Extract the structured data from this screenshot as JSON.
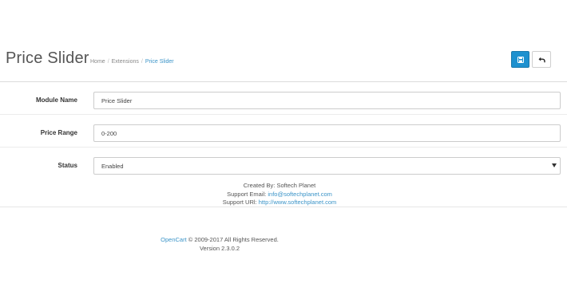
{
  "header": {
    "title": "Price Slider",
    "breadcrumb": [
      "Home",
      "Extensions",
      "Price Slider"
    ],
    "separator": "/"
  },
  "toolbar": {
    "save_icon": "save-icon",
    "back_icon": "back-arrow-icon",
    "save_color": "#1e91cf"
  },
  "form": {
    "module_name": {
      "label": "Module Name",
      "value": "Price Slider"
    },
    "price_range": {
      "label": "Price Range",
      "value": "0-200"
    },
    "status": {
      "label": "Status",
      "value": "Enabled"
    }
  },
  "credits": {
    "created_by": "Created By: Softech Planet",
    "email_label": "Support Email:",
    "email": "info@softechplanet.com",
    "url_label": "Support URl:",
    "url": "http://www.softechplanet.com"
  },
  "footer": {
    "brand": "OpenCart",
    "copyright": "© 2009-2017 All Rights Reserved.",
    "version": "Version 2.3.0.2"
  }
}
